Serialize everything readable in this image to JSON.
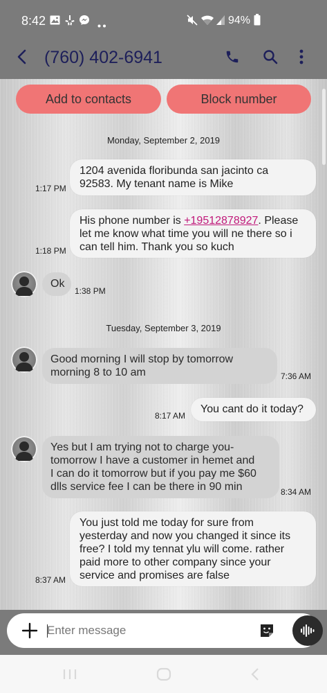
{
  "status_bar": {
    "time": "8:42",
    "battery": "94%",
    "notification_icons": [
      "gallery-icon",
      "yelp-icon",
      "messenger-icon",
      "more-dots-icon"
    ],
    "system_icons": [
      "mute-icon",
      "wifi-icon",
      "signal-icon",
      "battery-icon"
    ]
  },
  "header": {
    "title": "(760) 402-6941",
    "actions": [
      "back-arrow-icon",
      "phone-icon",
      "search-icon",
      "more-vert-icon"
    ]
  },
  "actions": {
    "add_contact": "Add to contacts",
    "block_number": "Block number"
  },
  "conversation": {
    "date1": "Monday, September 2, 2019",
    "date2": "Tuesday, September 3, 2019",
    "messages": [
      {
        "direction": "out",
        "time": "1:17 PM",
        "lines": [
          "1204 avenida floribunda san jacinto ca",
          "92583. My tenant name is Mike"
        ]
      },
      {
        "direction": "out",
        "time": "1:18 PM",
        "pre": "His phone number is ",
        "link": "+19512878927",
        "post": ". Please",
        "lines": [
          "let me know what time you will ne there so i",
          "can tell him. Thank you so kuch"
        ]
      },
      {
        "direction": "in",
        "time": "1:38 PM",
        "lines": [
          "Ok"
        ]
      },
      {
        "direction": "in",
        "time": "7:36 AM",
        "lines": [
          "Good morning I will stop by tomorrow",
          "morning 8 to 10 am"
        ]
      },
      {
        "direction": "out",
        "time": "8:17 AM",
        "lines": [
          "You cant do it today?"
        ]
      },
      {
        "direction": "in",
        "time": "8:34 AM",
        "lines": [
          "Yes but I am trying not to charge you-",
          "tomorrow I have a customer in hemet and",
          "I can do it tomorrow but if you pay me  $60",
          "dlls service fee I can  be  there in 90 min"
        ]
      },
      {
        "direction": "out",
        "time": "8:37 AM",
        "lines": [
          "You just told me today for sure from",
          "yesterday and now you changed it since its",
          "free? I told my tennat ylu will come.  rather",
          "paid more to other company since your",
          "service and promises are false"
        ]
      }
    ]
  },
  "composer": {
    "placeholder": "Enter message"
  },
  "colors": {
    "bar_gray": "#7b7b7b",
    "title_navy": "#1d1f5a",
    "action_button": "#f07575",
    "link_magenta": "#c0197a"
  }
}
